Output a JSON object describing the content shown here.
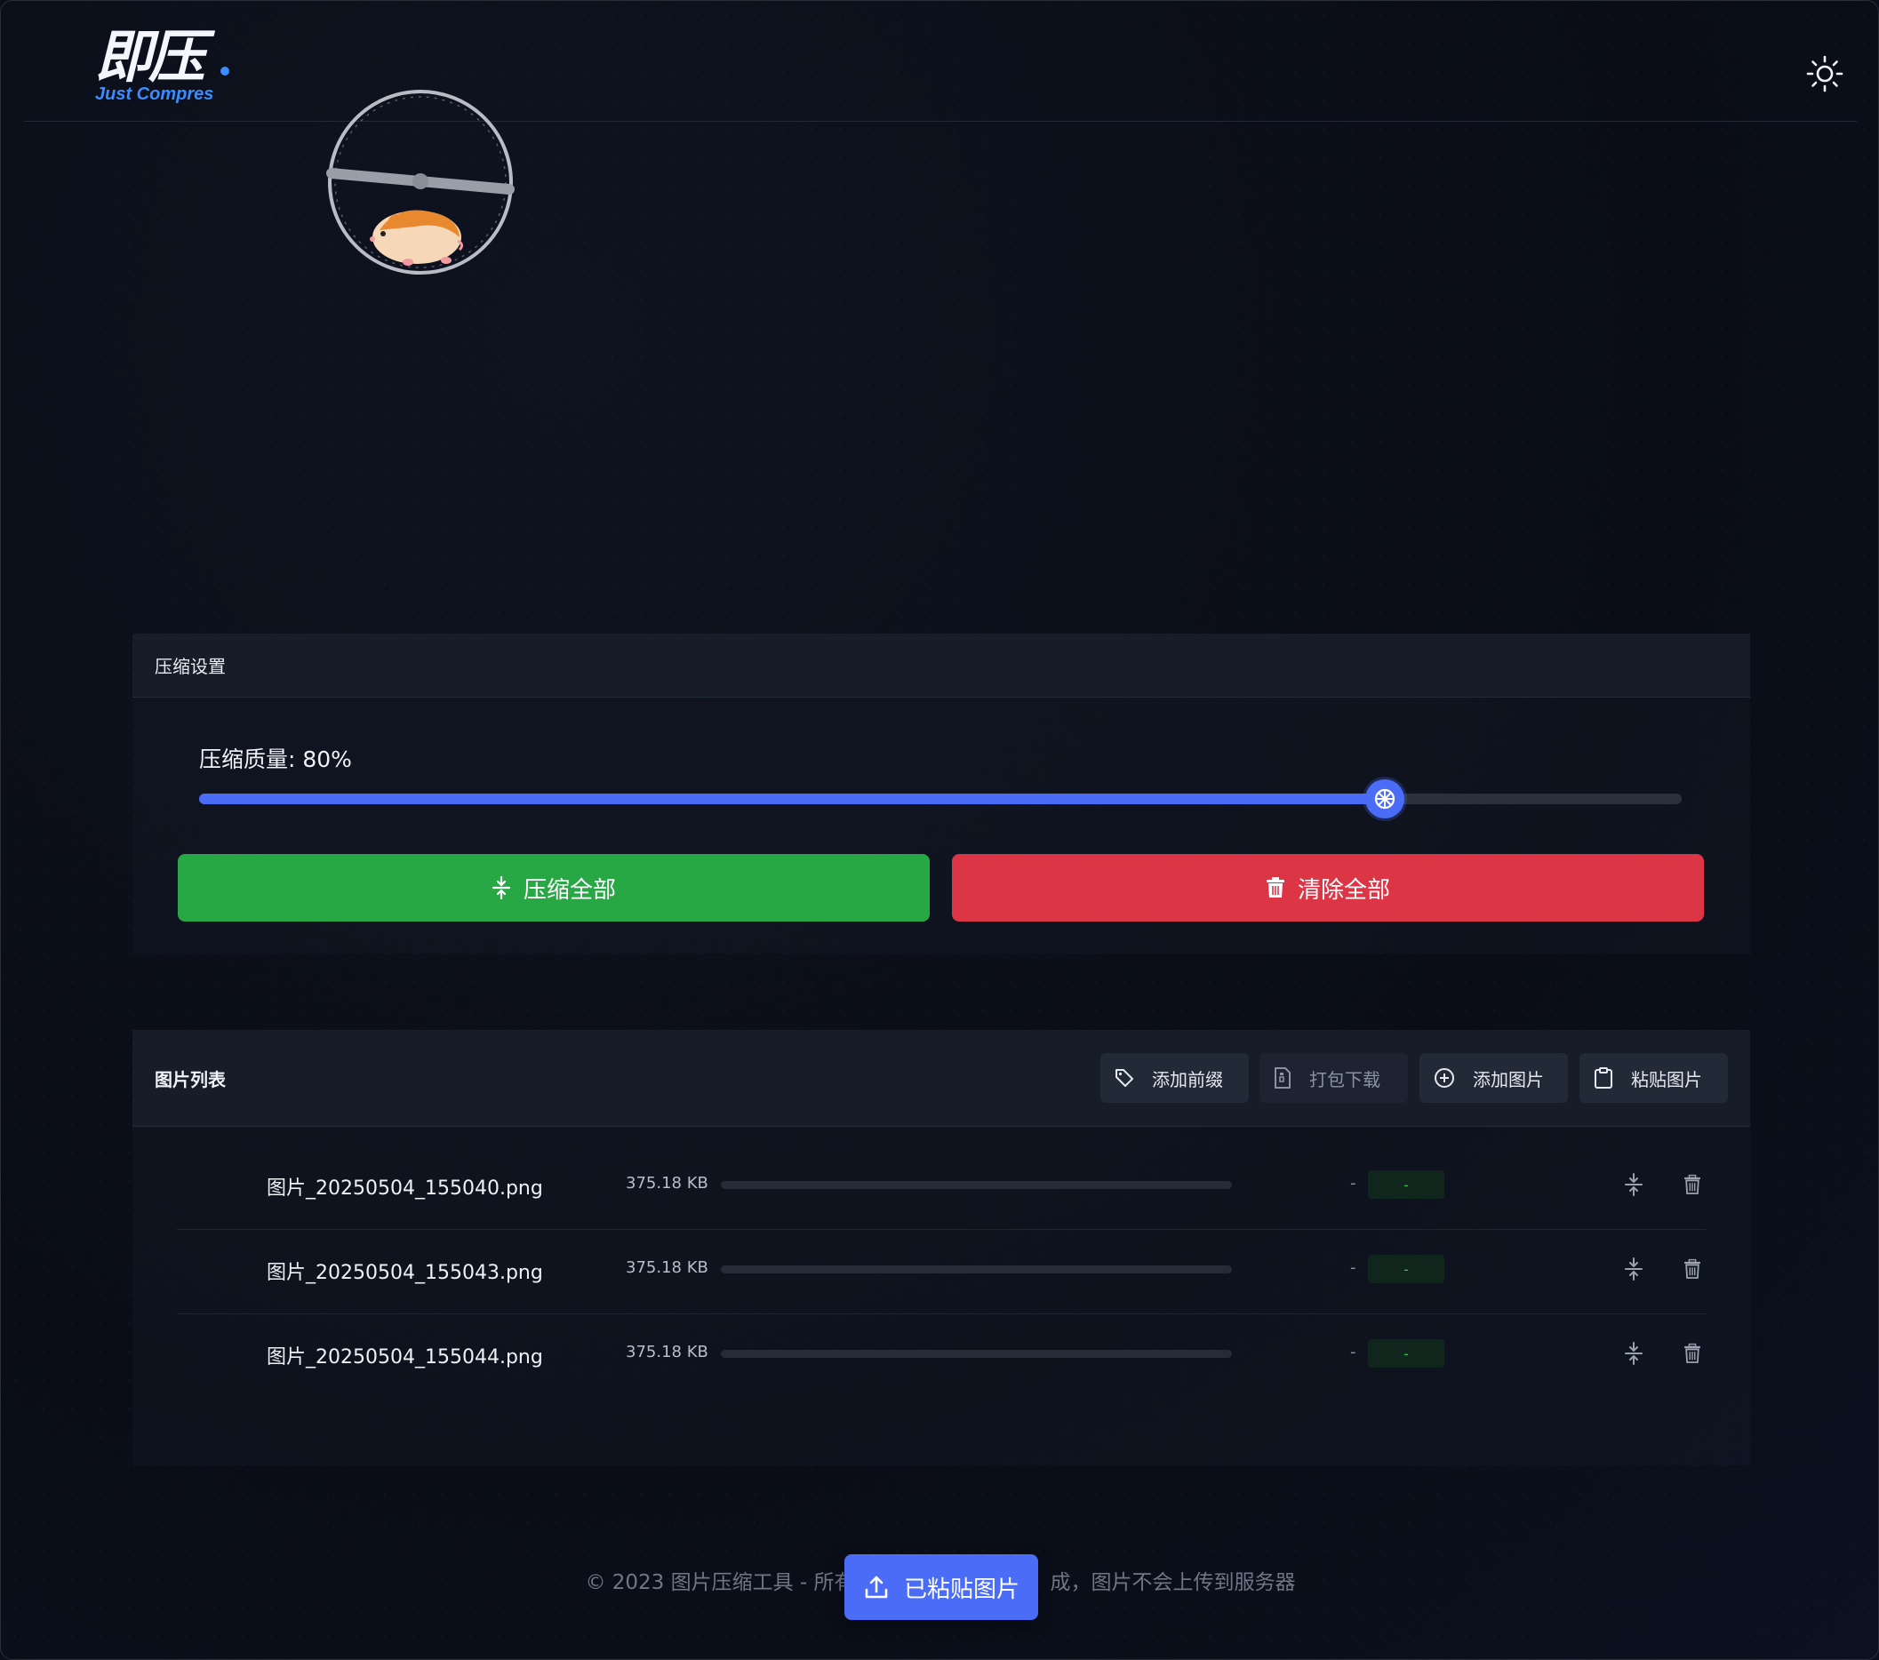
{
  "app": {
    "logo_text": "即压",
    "logo_subtitle": "Just Compres",
    "theme_icon": "sun-icon"
  },
  "settings": {
    "title": "压缩设置",
    "quality_label": "压缩质量: 80%",
    "quality_value": 0.8,
    "compress_all_label": "压缩全部",
    "clear_all_label": "清除全部",
    "colors": {
      "accent": "#4a6cf7",
      "success": "#28a745",
      "danger": "#dc3545"
    }
  },
  "image_list": {
    "title": "图片列表",
    "toolbar": {
      "add_prefix": "添加前缀",
      "download_zip": "打包下载",
      "add_image": "添加图片",
      "paste_image": "粘贴图片"
    },
    "rows": [
      {
        "name": "图片_20250504_155040.png",
        "size": "375.18 KB",
        "compressed": "-",
        "ratio": "-"
      },
      {
        "name": "图片_20250504_155043.png",
        "size": "375.18 KB",
        "compressed": "-",
        "ratio": "-"
      },
      {
        "name": "图片_20250504_155044.png",
        "size": "375.18 KB",
        "compressed": "-",
        "ratio": "-"
      }
    ]
  },
  "footer": {
    "text_left": "© 2023 图片压缩工具 - 所有",
    "text_right": "成，图片不会上传到服务器"
  },
  "paste_toast": {
    "label": "已粘贴图片"
  }
}
